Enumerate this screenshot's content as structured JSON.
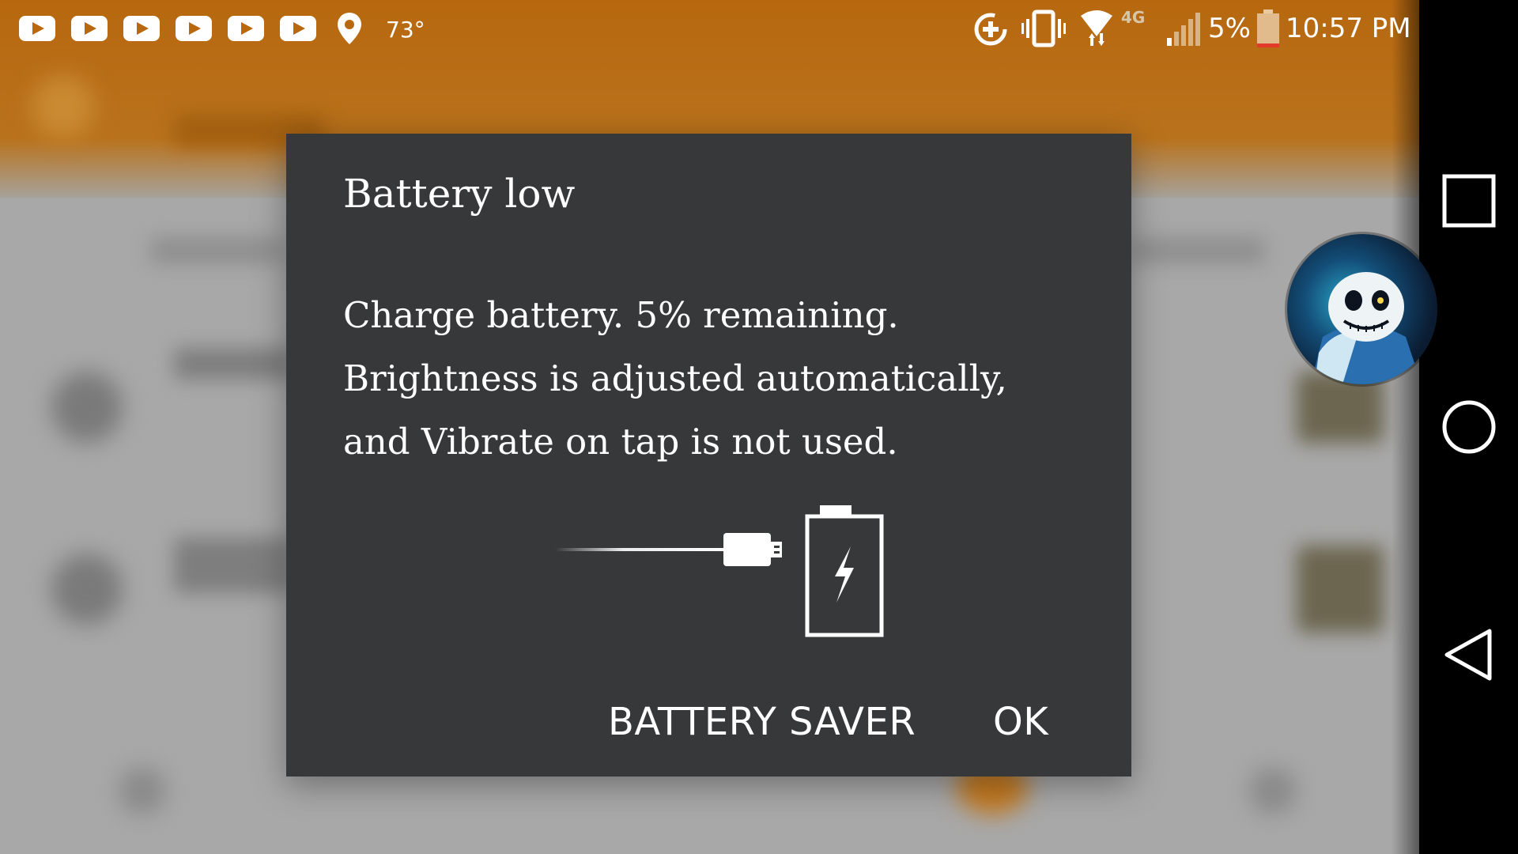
{
  "status_bar": {
    "notifications": [
      "youtube-icon",
      "youtube-icon",
      "youtube-icon",
      "youtube-icon",
      "youtube-icon",
      "youtube-icon",
      "location-pin-icon"
    ],
    "temperature": "73°",
    "network_type": "4G",
    "battery_percent": "5%",
    "time": "10:57 PM",
    "icons": [
      "data-saver-icon",
      "vibrate-icon",
      "wifi-icon",
      "signal-icon",
      "battery-icon"
    ],
    "accent_color": "#b8680f"
  },
  "dialog": {
    "title": "Battery low",
    "message_lines": [
      "Charge battery. 5% remaining.",
      "Brightness is adjusted automatically,",
      "and Vibrate on tap is not used."
    ],
    "illustration": [
      "usb-cable-icon",
      "battery-charging-icon"
    ],
    "buttons": {
      "battery_saver": "BATTERY SAVER",
      "ok": "OK"
    },
    "background_color": "#37383a"
  },
  "nav_bar": {
    "buttons": [
      "recents-square-icon",
      "home-circle-icon",
      "back-triangle-icon"
    ]
  },
  "chat_head": {
    "icon": "chat-head-avatar"
  }
}
